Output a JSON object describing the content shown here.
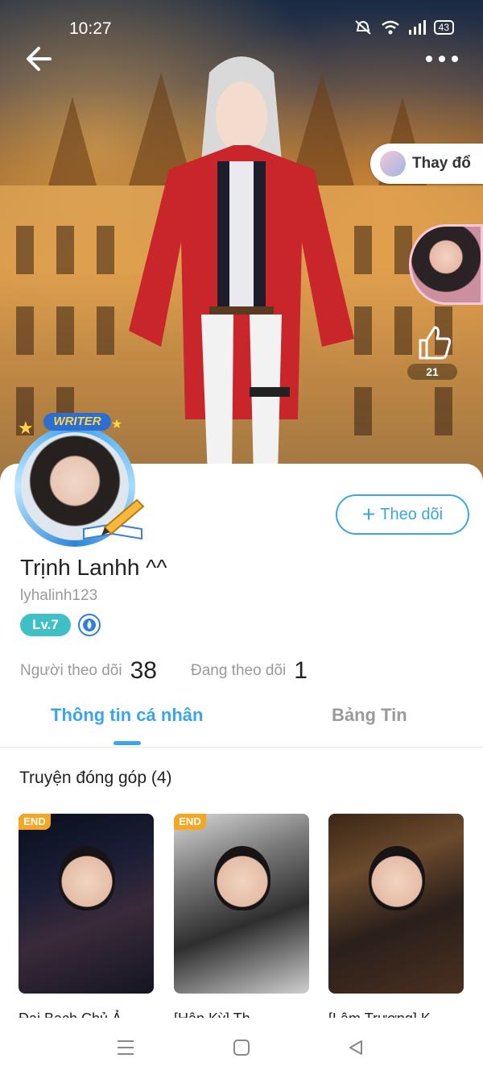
{
  "status_bar": {
    "time": "10:27",
    "battery": "43"
  },
  "header": {
    "change_label": "Thay đổ",
    "like_count": "21"
  },
  "profile": {
    "writer_badge": "WRITER",
    "follow_label": "Theo dõi",
    "display_name": "Trịnh Lanhh ^^",
    "username": "lyhalinh123",
    "level": "Lv.7",
    "followers_label": "Người theo dõi",
    "followers_count": "38",
    "following_label": "Đang theo dõi",
    "following_count": "1"
  },
  "tabs": [
    {
      "label": "Thông tin cá nhân",
      "active": true
    },
    {
      "label": "Bảng Tin",
      "active": false
    }
  ],
  "section": {
    "title": "Truyện đóng góp (4)"
  },
  "stories": [
    {
      "badge": "END",
      "title": "Đại Bạch Chủ Ả..."
    },
    {
      "badge": "END",
      "title": "[Hân Kỳ] Th..."
    },
    {
      "badge": "",
      "title": "[Lâm Trương] K..."
    }
  ],
  "colors": {
    "accent": "#3aa5e8",
    "level_badge": "#3ec0c6",
    "end_badge": "#f5a623"
  },
  "icons": [
    "back-arrow-icon",
    "more-icon",
    "thumbs-up-icon",
    "plus-icon",
    "drop-icon",
    "menu-icon",
    "home-square-icon",
    "back-triangle-icon"
  ]
}
